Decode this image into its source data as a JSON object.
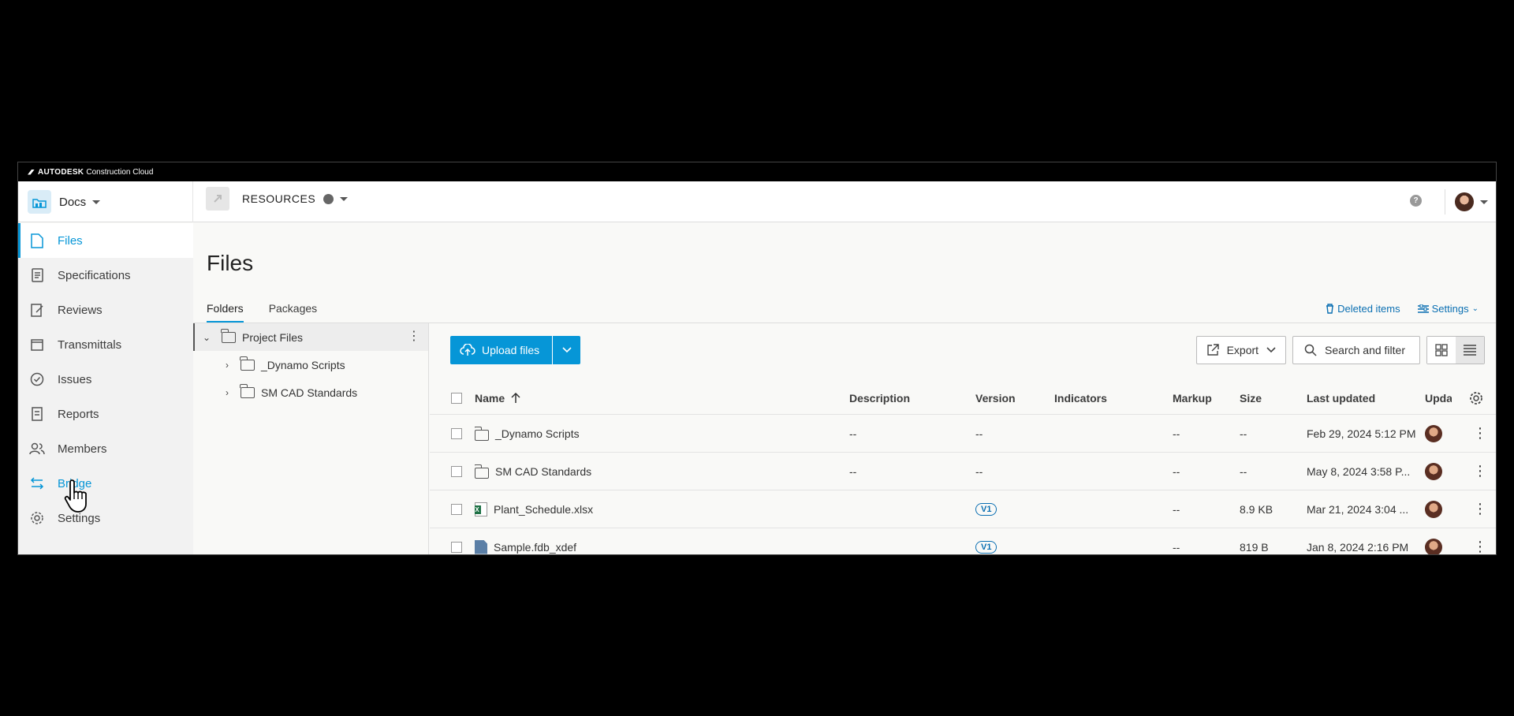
{
  "topbar": {
    "brand": "AUTODESK",
    "brand_sub": "Construction Cloud"
  },
  "header": {
    "module": "Docs",
    "project": "RESOURCES"
  },
  "sidebar": {
    "items": [
      {
        "label": "Files",
        "icon": "file-icon"
      },
      {
        "label": "Specifications",
        "icon": "specifications-icon"
      },
      {
        "label": "Reviews",
        "icon": "reviews-icon"
      },
      {
        "label": "Transmittals",
        "icon": "transmittals-icon"
      },
      {
        "label": "Issues",
        "icon": "issues-icon"
      },
      {
        "label": "Reports",
        "icon": "reports-icon"
      },
      {
        "label": "Members",
        "icon": "members-icon"
      },
      {
        "label": "Bridge",
        "icon": "bridge-icon"
      },
      {
        "label": "Settings",
        "icon": "gear-icon"
      }
    ]
  },
  "page": {
    "title": "Files",
    "tabs": [
      "Folders",
      "Packages"
    ],
    "deleted_items": "Deleted items",
    "settings": "Settings"
  },
  "tree": {
    "root": "Project Files",
    "children": [
      "_Dynamo Scripts",
      "SM CAD Standards"
    ]
  },
  "toolbar": {
    "upload": "Upload files",
    "export": "Export",
    "search": "Search and filter"
  },
  "table": {
    "headers": [
      "Name",
      "Description",
      "Version",
      "Indicators",
      "Markup",
      "Size",
      "Last updated",
      "Upda"
    ],
    "rows": [
      {
        "type": "folder",
        "name": "_Dynamo Scripts",
        "description": "--",
        "version": "--",
        "markup": "--",
        "size": "--",
        "updated": "Feb 29, 2024 5:12 PM"
      },
      {
        "type": "folder",
        "name": "SM CAD Standards",
        "description": "--",
        "version": "--",
        "markup": "--",
        "size": "--",
        "updated": "May 8, 2024 3:58 P..."
      },
      {
        "type": "xlsx",
        "name": "Plant_Schedule.xlsx",
        "description": "",
        "version": "V1",
        "markup": "--",
        "size": "8.9 KB",
        "updated": "Mar 21, 2024 3:04 ..."
      },
      {
        "type": "file",
        "name": "Sample.fdb_xdef",
        "description": "",
        "version": "V1",
        "markup": "--",
        "size": "819 B",
        "updated": "Jan 8, 2024 2:16 PM"
      }
    ]
  },
  "colors": {
    "accent": "#0696d7",
    "link": "#0a6fb2"
  }
}
